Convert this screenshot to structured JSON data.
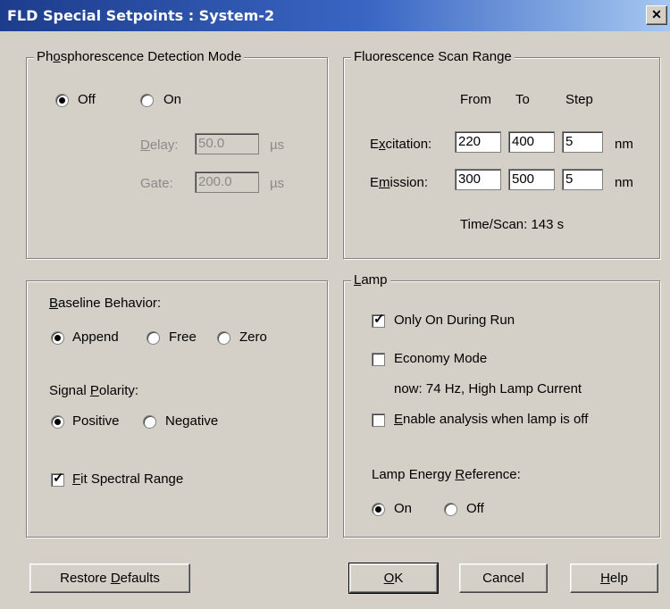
{
  "title": "FLD Special Setpoints : System-2",
  "close_glyph": "✕",
  "phosphorescence": {
    "legend_pre": "Ph",
    "legend_key": "o",
    "legend_post": "sphorescence Detection Mode",
    "off_label": "Off",
    "on_label": "On",
    "selected": "off",
    "delay_key": "D",
    "delay_rest": "elay:",
    "delay_value": "50.0",
    "gate_label": "Gate:",
    "gate_value": "200.0",
    "unit": "µs"
  },
  "scan_range": {
    "legend": "Fluorescence Scan Range",
    "col_from": "From",
    "col_to": "To",
    "col_step": "Step",
    "excitation_pre": "E",
    "excitation_key": "x",
    "excitation_post": "citation:",
    "excitation": {
      "from": "220",
      "to": "400",
      "step": "5"
    },
    "emission_pre": "E",
    "emission_key": "m",
    "emission_post": "ission:",
    "emission": {
      "from": "300",
      "to": "500",
      "step": "5"
    },
    "unit": "nm",
    "time_scan": "Time/Scan: 143 s"
  },
  "behavior": {
    "baseline_key": "B",
    "baseline_rest": "aseline Behavior:",
    "append": "Append",
    "free": "Free",
    "zero": "Zero",
    "baseline_selected": "append",
    "polarity_pre": "Signal ",
    "polarity_key": "P",
    "polarity_post": "olarity:",
    "positive": "Positive",
    "negative": "Negative",
    "polarity_selected": "positive",
    "fit_key": "F",
    "fit_rest": "it Spectral Range",
    "fit_checked": true
  },
  "lamp": {
    "legend_key": "L",
    "legend_rest": "amp",
    "only_on": "Only On During Run",
    "only_on_checked": true,
    "economy": "Economy Mode",
    "economy_checked": false,
    "now_text": "now: 74 Hz, High Lamp Current",
    "enable_key": "E",
    "enable_rest": "nable analysis when lamp is off",
    "enable_checked": false,
    "ref_pre": "Lamp Energy ",
    "ref_key": "R",
    "ref_post": "eference:",
    "ref_on": "On",
    "ref_off": "Off",
    "ref_selected": "on"
  },
  "buttons": {
    "restore_pre": "Restore ",
    "restore_key": "D",
    "restore_post": "efaults",
    "ok_key": "O",
    "ok_rest": "K",
    "cancel": "Cancel",
    "help_key": "H",
    "help_rest": "elp"
  }
}
